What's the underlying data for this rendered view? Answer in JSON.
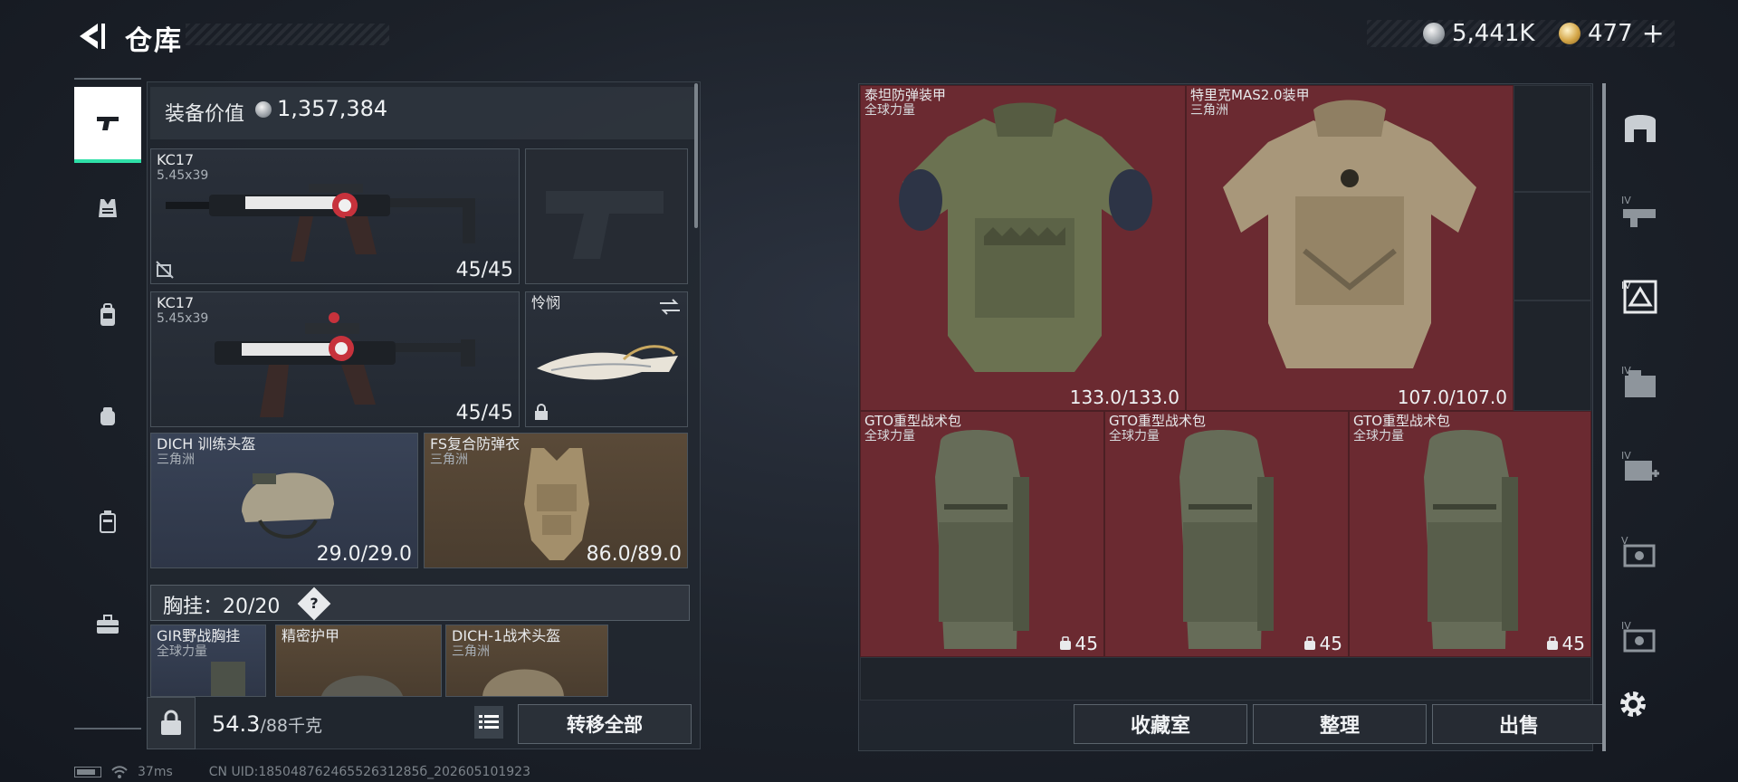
{
  "header": {
    "title": "仓库",
    "silver": "5,441K",
    "gold": "477",
    "gold_plus": "+"
  },
  "left_rail": {
    "items": [
      "weapons",
      "armor",
      "backpack",
      "rig",
      "case",
      "toolbox"
    ]
  },
  "loadout": {
    "equip_label": "装备价值",
    "equip_value": "1,357,384",
    "slots": [
      {
        "name": "KC17",
        "sub": "5.45x39",
        "value": "45/45",
        "style": "weapon"
      },
      {
        "name": "",
        "sub": "",
        "value": "",
        "style": "empty-pistol"
      },
      {
        "name": "KC17",
        "sub": "5.45x39",
        "value": "45/45",
        "style": "weapon"
      },
      {
        "name": "怜悯",
        "sub": "",
        "value": "",
        "style": "melee"
      },
      {
        "name": "DICH 训练头盔",
        "sub": "三角洲",
        "value": "29.0/29.0",
        "style": "helmet"
      },
      {
        "name": "FS复合防弹衣",
        "sub": "三角洲",
        "value": "86.0/89.0",
        "style": "vest"
      }
    ],
    "rig": {
      "label": "胸挂：20/20",
      "help": "?"
    },
    "rig_items": [
      {
        "name": "GIR野战胸挂",
        "sub": "全球力量"
      },
      {
        "name": "精密护甲",
        "sub": ""
      },
      {
        "name": "DICH-1战术头盔",
        "sub": "三角洲"
      }
    ],
    "weight": "54.3",
    "weight_max": "/88千克",
    "transfer_label": "转移全部"
  },
  "stash": {
    "items": [
      {
        "name": "泰坦防弹装甲",
        "sub": "全球力量",
        "value": "133.0/133.0",
        "kind": "armor-green"
      },
      {
        "name": "特里克MAS2.0装甲",
        "sub": "三角洲",
        "value": "107.0/107.0",
        "kind": "armor-camo"
      },
      {
        "name": "GTO重型战术包",
        "sub": "全球力量",
        "value": "45",
        "kind": "pack"
      },
      {
        "name": "GTO重型战术包",
        "sub": "全球力量",
        "value": "45",
        "kind": "pack"
      },
      {
        "name": "GTO重型战术包",
        "sub": "全球力量",
        "value": "45",
        "kind": "pack"
      }
    ],
    "buttons": {
      "fav": "收藏室",
      "sort": "整理",
      "sell": "出售"
    }
  },
  "status": {
    "ping": "37ms",
    "uid": "CN UID:18504876246552631285б_202605101923"
  },
  "colors": {
    "accent": "#2fe0a8",
    "red_cell": "#6b2a31",
    "gold_slot": "#5a4a38",
    "blue_slot": "#394357"
  }
}
